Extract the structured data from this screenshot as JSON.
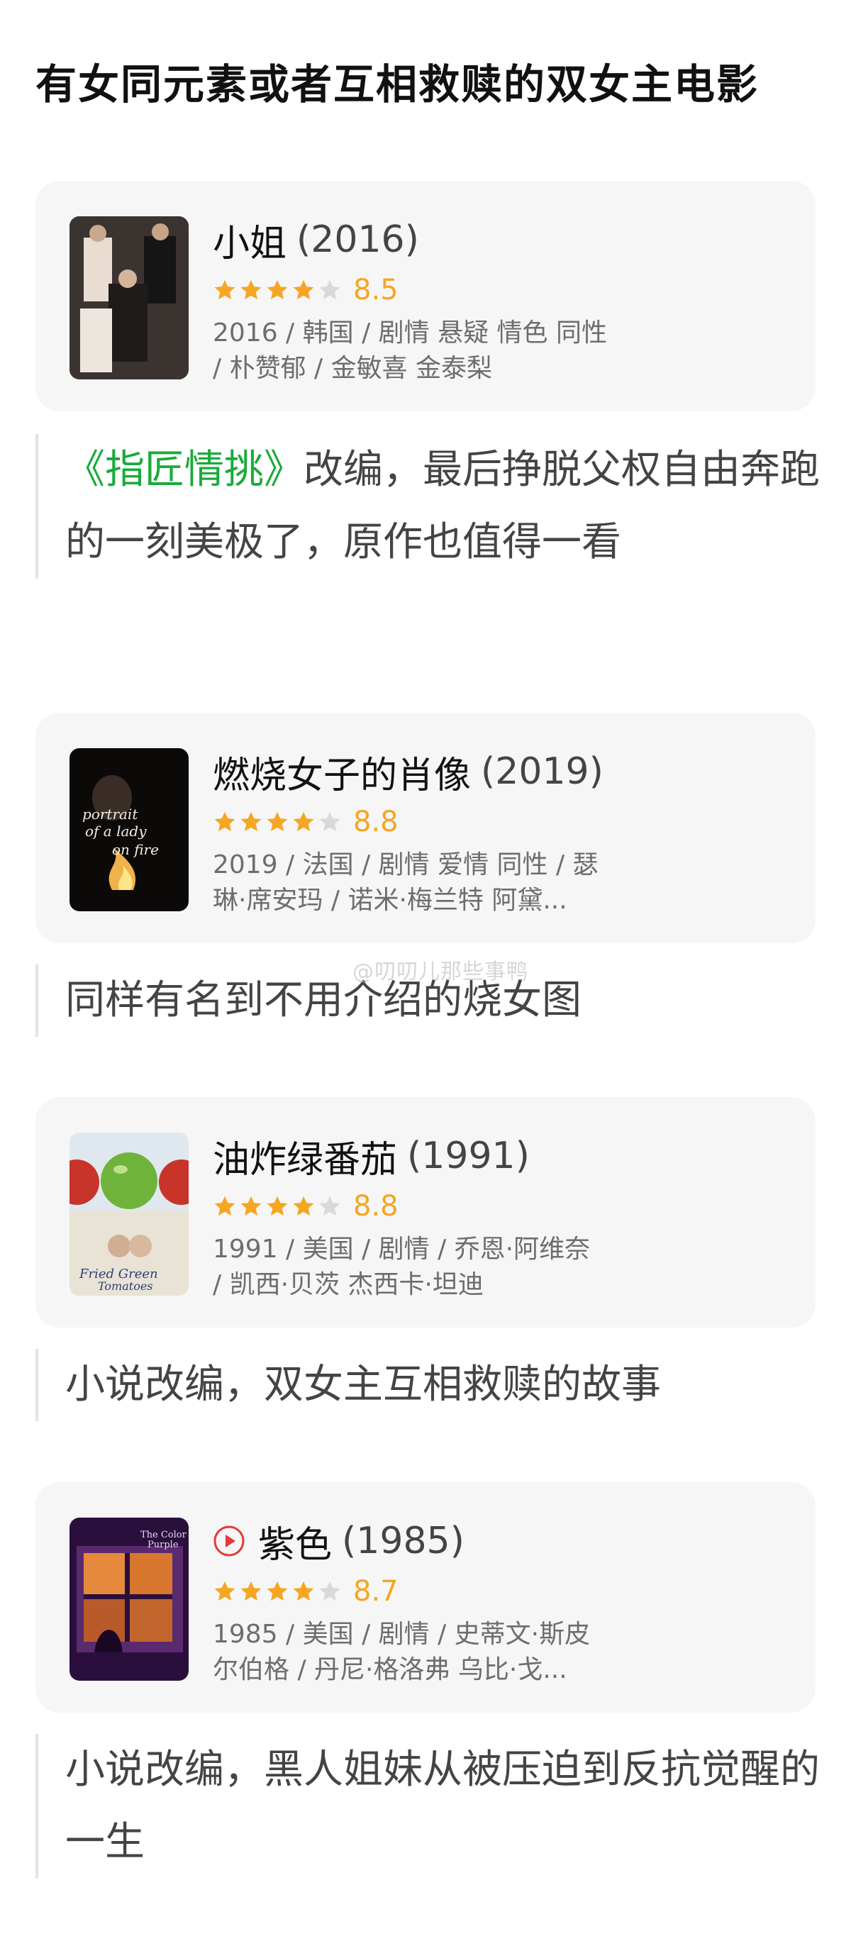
{
  "page": {
    "title": "有女同元素或者互相救赎的双女主电影"
  },
  "watermark": "@叨叨儿那些事鸭",
  "colors": {
    "star": "#f5a623",
    "star_empty": "#d9d9d9",
    "link": "#1aab3b",
    "card_bg": "#f6f6f6"
  },
  "movies": [
    {
      "title": "小姐",
      "year": "(2016)",
      "score": "8.5",
      "stars": 4,
      "meta_line1": "2016 / 韩国 / 剧情 悬疑 情色 同性",
      "meta_line2": "/ 朴赞郁 / 金敏喜 金泰梨",
      "note_link": "《指匠情挑》",
      "note": "改编，最后挣脱父权自由奔跑的一刻美极了，原作也值得一看",
      "poster_icon": "poster-the-handmaiden"
    },
    {
      "title": "燃烧女子的肖像",
      "year": "(2019)",
      "score": "8.8",
      "stars": 4,
      "meta_line1": "2019 / 法国 / 剧情 爱情 同性 / 瑟",
      "meta_line2": "琳·席安玛 / 诺米·梅兰特 阿黛...",
      "note": "同样有名到不用介绍的烧女图",
      "poster_text": "portrait of a lady on fire"
    },
    {
      "title": "油炸绿番茄",
      "year": "(1991)",
      "score": "8.8",
      "stars": 4,
      "meta_line1": "1991 / 美国 / 剧情 / 乔恩·阿维奈",
      "meta_line2": "/ 凯西·贝茨 杰西卡·坦迪",
      "note": "小说改编，双女主互相救赎的故事",
      "poster_text": "Fried Green Tomatoes"
    },
    {
      "title": "紫色",
      "year": "(1985)",
      "score": "8.7",
      "stars": 4,
      "meta_line1": "1985 / 美国 / 剧情 / 史蒂文·斯皮",
      "meta_line2": "尔伯格 / 丹尼·格洛弗 乌比·戈...",
      "note": "小说改编，黑人姐妹从被压迫到反抗觉醒的一生",
      "poster_text": "The Color Purple",
      "icon": "play-circle-icon"
    }
  ]
}
